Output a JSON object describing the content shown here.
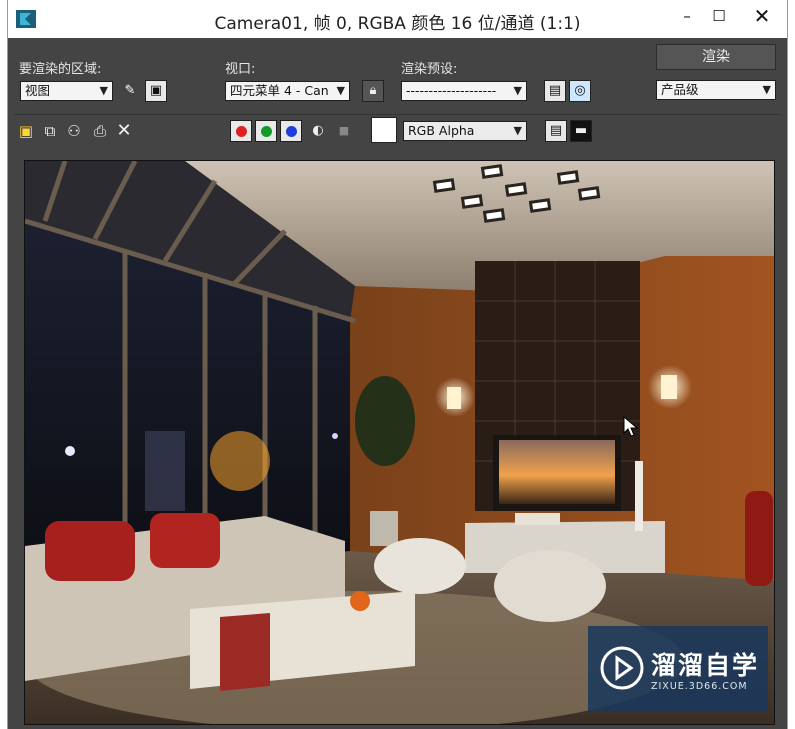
{
  "window": {
    "title": "Camera01, 帧 0, RGBA 颜色 16 位/通道 (1:1)",
    "minimize": "–",
    "maximize": "☐",
    "close": "✕"
  },
  "controls": {
    "area_label": "要渲染的区域:",
    "area_value": "视图",
    "viewport_label": "视口:",
    "viewport_value": "四元菜单 4 - Can",
    "preset_label": "渲染预设:",
    "preset_value": "--------------------",
    "render_button": "渲染",
    "quality_value": "产品级",
    "channel_value": "RGB Alpha"
  },
  "colors": {
    "red_channel": "#e02020",
    "green_channel": "#139a2b",
    "blue_channel": "#1f3fd8",
    "watermark_bg": "#1a385c"
  },
  "icons": [
    "app-3dsmax-icon",
    "edit-region-icon",
    "auto-region-icon",
    "lock-icon",
    "preset-load-icon",
    "environment-icon",
    "save-image-icon",
    "copy-image-icon",
    "clone-window-icon",
    "print-icon",
    "clear-icon",
    "mono-toggle-icon",
    "alpha-toggle-icon",
    "display-correction-icon",
    "frame-buffer-icon",
    "play-logo-icon"
  ],
  "watermark": {
    "name": "溜溜自学",
    "url": "ZIXUE.3D66.COM"
  }
}
